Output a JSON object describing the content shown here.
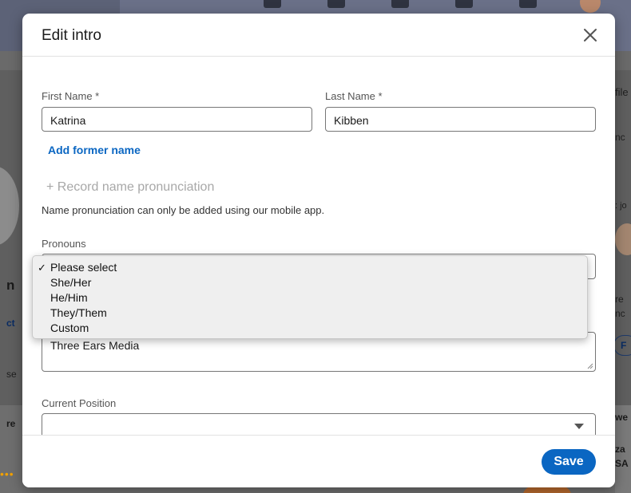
{
  "modal": {
    "title": "Edit intro",
    "close_icon": "close-icon"
  },
  "form": {
    "first_name": {
      "label": "First Name *",
      "value": "Katrina"
    },
    "last_name": {
      "label": "Last Name *",
      "value": "Kibben"
    },
    "add_former_name": "Add former name",
    "record_pronunciation": "+ Record name pronunciation",
    "pronunciation_note": "Name pronunciation can only be added using our mobile app.",
    "pronouns": {
      "label": "Pronouns",
      "selected": "Please select",
      "options": [
        "Please select",
        "She/Her",
        "He/Him",
        "They/Them",
        "Custom"
      ]
    },
    "headline_value": "Three Ears Media",
    "current_position": {
      "label": "Current Position",
      "value": ""
    }
  },
  "footer": {
    "save_label": "Save"
  },
  "background": {
    "left_fragments": [
      "n",
      "ct",
      "se",
      "re"
    ],
    "right_fragments": [
      "file",
      "nc",
      ": jo",
      "re",
      "nc",
      "F",
      "we",
      "za",
      "SA"
    ]
  },
  "colors": {
    "accent": "#0a66c2",
    "overlay": "#6a6a6a"
  }
}
